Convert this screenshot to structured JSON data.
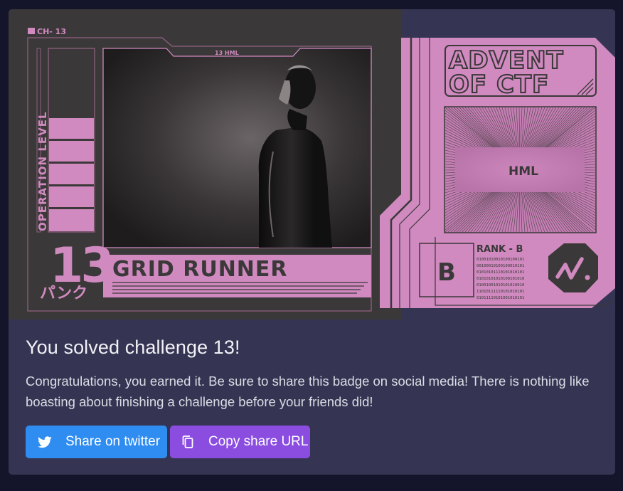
{
  "badge": {
    "corner_code": "CH- 13",
    "screen_label": "13 HML",
    "vertical_label": "OPERATION LEVEL",
    "number": "13",
    "kana": "パンク",
    "challenge_name": "GRID RUNNER",
    "brand_line1": "ADVENT",
    "brand_line2": "OF CTF",
    "center_label": "HML",
    "rank_title": "RANK - B",
    "rank_letter": "B",
    "binary_lines": [
      "01001010010100100101",
      "00100010100100010101",
      "01010101110101010101",
      "01010101010100101010",
      "01001001010101010010",
      "11010111110101010101",
      "01011110101001010101"
    ],
    "colors": {
      "pink": "#d08ac0",
      "dark": "#3a3838",
      "line": "#2b2a2f"
    }
  },
  "panel": {
    "title": "You solved challenge 13!",
    "description": "Congratulations, you earned it. Be sure to share this badge on social media! There is nothing like boasting about finishing a challenge before your friends did!"
  },
  "buttons": {
    "twitter_label": "Share on twitter",
    "copy_label": "Copy share URL",
    "twitter_icon": "twitter-icon",
    "copy_icon": "copy-icon",
    "twitter_color": "#2f8cf0",
    "copy_color": "#8a4de0"
  }
}
